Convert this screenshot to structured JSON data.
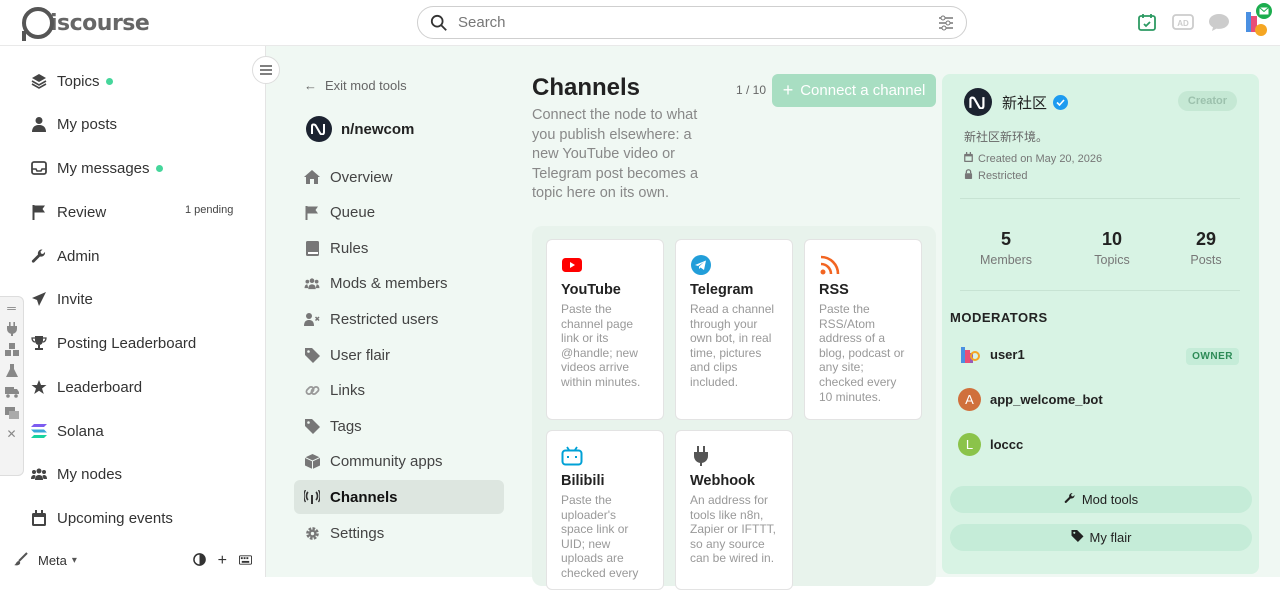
{
  "header": {
    "logo_text": "iscourse",
    "search_placeholder": "Search"
  },
  "sidebar": {
    "items": [
      {
        "label": "Topics",
        "icon": "layers-icon",
        "dot": true
      },
      {
        "label": "My posts",
        "icon": "user-icon",
        "dot": false
      },
      {
        "label": "My messages",
        "icon": "inbox-icon",
        "dot": true
      },
      {
        "label": "Review",
        "icon": "flag-icon",
        "dot": false,
        "pending": "1 pending"
      },
      {
        "label": "Admin",
        "icon": "wrench-icon",
        "dot": false
      },
      {
        "label": "Invite",
        "icon": "paper-plane-icon",
        "dot": false
      },
      {
        "label": "Posting Leaderboard",
        "icon": "trophy-icon",
        "dot": false
      },
      {
        "label": "Leaderboard",
        "icon": "star-icon",
        "dot": false
      },
      {
        "label": "Solana",
        "icon": "solana-icon",
        "dot": false
      },
      {
        "label": "My nodes",
        "icon": "users-icon",
        "dot": false
      },
      {
        "label": "Upcoming events",
        "icon": "calendar-icon",
        "dot": false
      }
    ],
    "footer": {
      "label": "Meta"
    }
  },
  "modnav": {
    "exit": "Exit mod tools",
    "node_name": "n/newcom",
    "items": [
      {
        "label": "Overview",
        "icon": "home-icon"
      },
      {
        "label": "Queue",
        "icon": "flag-icon"
      },
      {
        "label": "Rules",
        "icon": "book-icon"
      },
      {
        "label": "Mods & members",
        "icon": "users-icon"
      },
      {
        "label": "Restricted users",
        "icon": "user-x-icon"
      },
      {
        "label": "User flair",
        "icon": "tag-icon"
      },
      {
        "label": "Links",
        "icon": "link-icon"
      },
      {
        "label": "Tags",
        "icon": "tag-icon"
      },
      {
        "label": "Community apps",
        "icon": "cube-icon"
      },
      {
        "label": "Channels",
        "icon": "broadcast-icon",
        "active": true
      },
      {
        "label": "Settings",
        "icon": "gear-icon"
      }
    ]
  },
  "channels": {
    "title": "Channels",
    "count": "1 / 10",
    "connect_label": "Connect a channel",
    "description": "Connect the node to what you publish elsewhere: a new YouTube video or Telegram post becomes a topic here on its own.",
    "cards": [
      {
        "name": "YouTube",
        "icon": "youtube-icon",
        "color": "#ff0000",
        "desc": "Paste the channel page link or its @handle; new videos arrive within minutes."
      },
      {
        "name": "Telegram",
        "icon": "telegram-icon",
        "color": "#229ed9",
        "desc": "Read a channel through your own bot, in real time, pictures and clips included."
      },
      {
        "name": "RSS",
        "icon": "rss-icon",
        "color": "#f26522",
        "desc": "Paste the RSS/Atom address of a blog, podcast or any site; checked every 10 minutes."
      },
      {
        "name": "Bilibili",
        "icon": "bilibili-icon",
        "color": "#00a1d6",
        "desc": "Paste the uploader's space link or UID; new uploads are checked every"
      },
      {
        "name": "Webhook",
        "icon": "plug-icon",
        "color": "#555555",
        "desc": "An address for tools like n8n, Zapier or IFTTT, so any source can be wired in."
      }
    ]
  },
  "panel": {
    "name": "新社区",
    "badge": "Creator",
    "description": "新社区新环境。",
    "created": "Created on May 20, 2026",
    "restricted": "Restricted",
    "stats": [
      {
        "num": "5",
        "label": "Members"
      },
      {
        "num": "10",
        "label": "Topics"
      },
      {
        "num": "29",
        "label": "Posts"
      }
    ],
    "moderators_title": "MODERATORS",
    "moderators": [
      {
        "name": "user1",
        "initial": "",
        "color": "#ffffff",
        "owner": "OWNER"
      },
      {
        "name": "app_welcome_bot",
        "initial": "A",
        "color": "#d0703c"
      },
      {
        "name": "loccc",
        "initial": "L",
        "color": "#8bc34a"
      }
    ],
    "mod_tools_label": "Mod tools",
    "my_flair_label": "My flair"
  }
}
